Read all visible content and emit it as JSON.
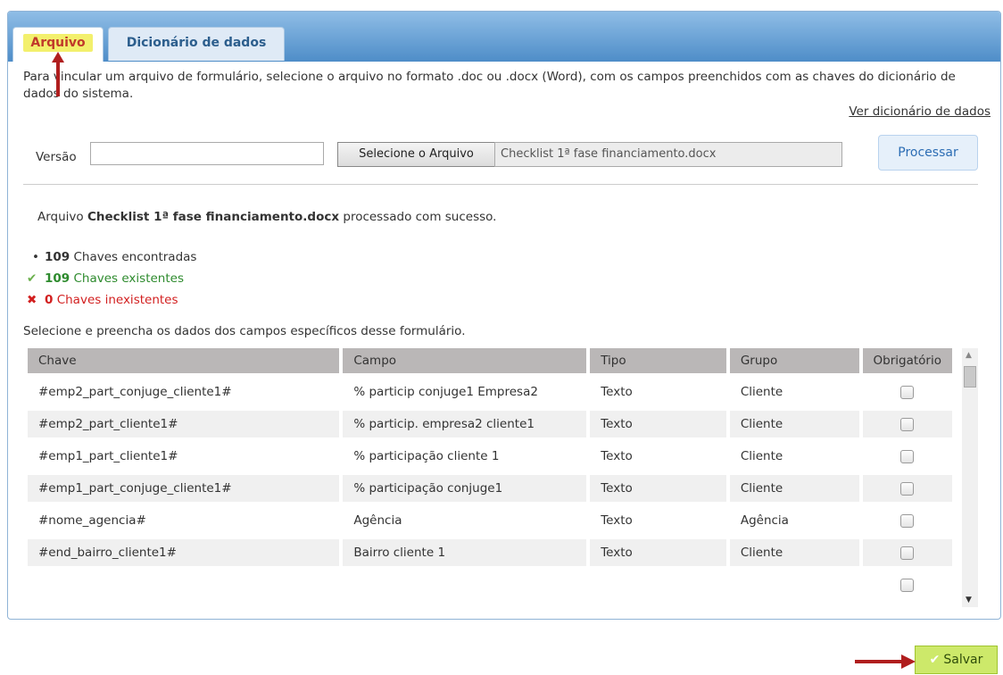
{
  "tabs": [
    {
      "label": "Arquivo"
    },
    {
      "label": "Dicionário de dados"
    }
  ],
  "intro": {
    "text": "Para vincular um arquivo de formulário, selecione o arquivo no formato .doc ou .docx (Word), com os campos preenchidos com as chaves do dicionário de dados do sistema.",
    "dictionary_link": "Ver dicionário de dados"
  },
  "form": {
    "version_label": "Versão",
    "version_value": "",
    "select_file_button": "Selecione o Arquivo",
    "file_name": "Checklist 1ª fase financiamento.docx",
    "process_button": "Processar"
  },
  "status": {
    "prefix": "Arquivo ",
    "file_name": "Checklist 1ª fase financiamento.docx",
    "suffix": " processado com sucesso."
  },
  "keys": {
    "found_count": "109",
    "found_label": " Chaves encontradas",
    "existing_count": "109",
    "existing_label": " Chaves existentes",
    "missing_count": "0",
    "missing_label": " Chaves inexistentes"
  },
  "fields_hint": "Selecione e preencha os dados dos campos específicos desse formulário.",
  "table": {
    "headers": [
      "Chave",
      "Campo",
      "Tipo",
      "Grupo",
      "Obrigatório"
    ],
    "rows": [
      {
        "chave": "#emp2_part_conjuge_cliente1#",
        "campo": "% particip conjuge1 Empresa2",
        "tipo": "Texto",
        "grupo": "Cliente"
      },
      {
        "chave": "#emp2_part_cliente1#",
        "campo": "% particip. empresa2 cliente1",
        "tipo": "Texto",
        "grupo": "Cliente"
      },
      {
        "chave": "#emp1_part_cliente1#",
        "campo": "% participação cliente 1",
        "tipo": "Texto",
        "grupo": "Cliente"
      },
      {
        "chave": "#emp1_part_conjuge_cliente1#",
        "campo": "% participação conjuge1",
        "tipo": "Texto",
        "grupo": "Cliente"
      },
      {
        "chave": "#nome_agencia#",
        "campo": "Agência",
        "tipo": "Texto",
        "grupo": "Agência"
      },
      {
        "chave": "#end_bairro_cliente1#",
        "campo": "Bairro cliente 1",
        "tipo": "Texto",
        "grupo": "Cliente"
      }
    ]
  },
  "footer": {
    "save_button": "Salvar"
  },
  "colors": {
    "tab_highlight": "#f3f06d",
    "save_button": "#cde96a",
    "annotation_arrow": "#b01e1e",
    "success": "#2e8b2e",
    "error": "#d21f1f"
  }
}
